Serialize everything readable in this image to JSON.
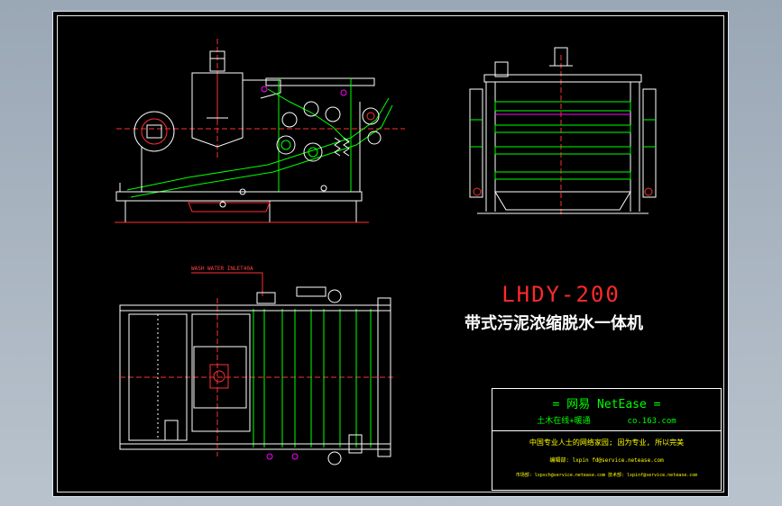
{
  "title": {
    "model": "LHDY-200",
    "name_cn": "带式污泥浓缩脱水一体机"
  },
  "annotation": {
    "wash_water_inlet": "WASH WATER INLET40A"
  },
  "title_block": {
    "brand_line": "=  网易 NetEase  =",
    "site_cn": "土木在线+暖通",
    "site_domain": "co.163.com",
    "slogan": "中国专业人士的网络家园; 因为专业, 所以完美",
    "editor": "编辑部: lxpin fd@service.netease.com",
    "contacts": "市场部: lxpsch@service.netease.com  技术部: lxpinf@service.netease.com"
  },
  "colors": {
    "background": "#000000",
    "frame": "#ffffff",
    "geometry": "#ffffff",
    "belt": "#00ff00",
    "piping": "#ff2020",
    "axes": "#ff3030",
    "accent": "#ff00ff",
    "brand_text": "#00ff00",
    "slogan_text": "#ffff00"
  }
}
